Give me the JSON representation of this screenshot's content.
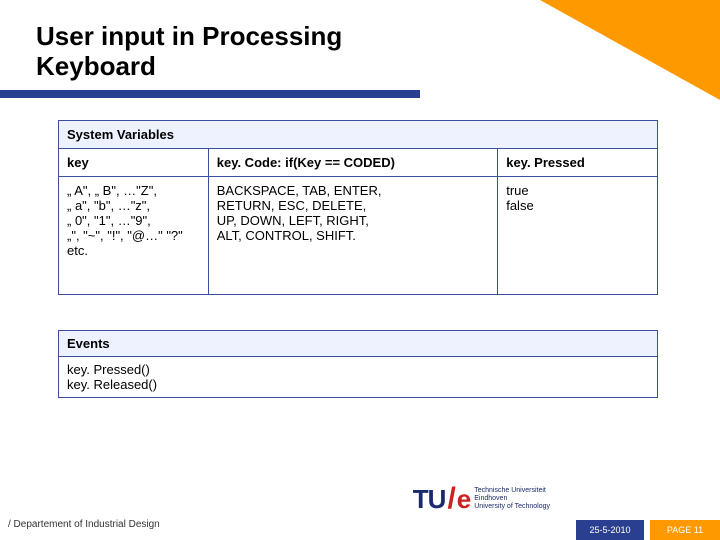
{
  "title": {
    "line1": "User input in Processing",
    "line2": "Keyboard"
  },
  "sysvars": {
    "header": "System Variables",
    "cols": [
      "key",
      "key. Code: if(Key == CODED)",
      "key. Pressed"
    ],
    "row": [
      "„ A\", „ B\", …\"Z\",\n„ a\", \"b\", …\"z\",\n„ 0\", \"1\", …\"9\",\n„\", \"~\", \"!\", \"@…\"  \"?\"\netc.",
      "BACKSPACE, TAB, ENTER,\nRETURN, ESC, DELETE,\nUP, DOWN, LEFT, RIGHT,\nALT, CONTROL, SHIFT.",
      "true\nfalse"
    ]
  },
  "events": {
    "header": "Events",
    "body": "key. Pressed()\nkey. Released()"
  },
  "footer": {
    "dept": "/ Departement of Industrial Design",
    "logo_mark": "TU",
    "logo_e": "e",
    "logo_words": "Technische Universiteit\nEindhoven\nUniversity of Technology",
    "date": "25-5-2010",
    "page": "PAGE 11"
  }
}
